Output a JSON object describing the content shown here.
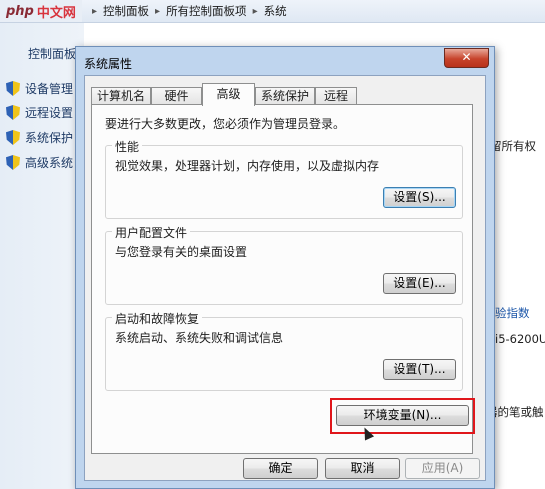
{
  "logo": {
    "php": "php",
    "cn": "中文网"
  },
  "breadcrumb": [
    "控制面板",
    "所有控制面板项",
    "系统"
  ],
  "left_pane": {
    "heading": "控制面板主",
    "items": [
      "设备管理",
      "远程设置",
      "系统保护",
      "高级系统"
    ]
  },
  "right_pane": {
    "text_rights": "留所有权",
    "text_index": "验指数",
    "text_cpu": "i5-6200U",
    "text_pen": "器的笔或触"
  },
  "dialog": {
    "title": "系统属性",
    "close_symbol": "✕",
    "tabs": [
      "计算机名",
      "硬件",
      "高级",
      "系统保护",
      "远程"
    ],
    "active_tab": "高级",
    "admin_note": "要进行大多数更改，您必须作为管理员登录。",
    "groups": [
      {
        "title": "性能",
        "desc": "视觉效果，处理器计划，内存使用，以及虚拟内存",
        "button": "设置(S)..."
      },
      {
        "title": "用户配置文件",
        "desc": "与您登录有关的桌面设置",
        "button": "设置(E)..."
      },
      {
        "title": "启动和故障恢复",
        "desc": "系统启动、系统失败和调试信息",
        "button": "设置(T)..."
      }
    ],
    "env_button": "环境变量(N)...",
    "ok": "确定",
    "cancel": "取消",
    "apply": "应用(A)"
  }
}
